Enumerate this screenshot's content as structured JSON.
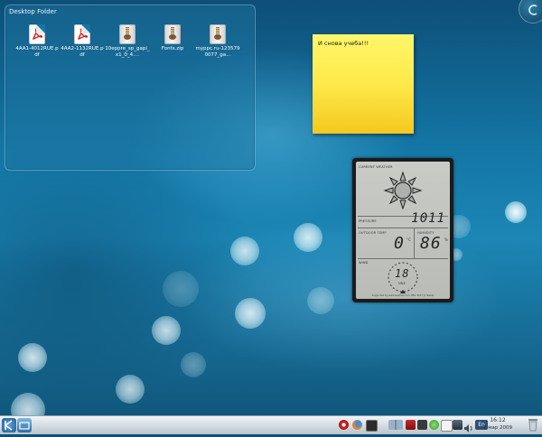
{
  "desktop": {
    "folder_view": {
      "title": "Desktop Folder",
      "files": [
        {
          "name": "4AA1-4012RUE.pdf",
          "type": "pdf"
        },
        {
          "name": "4AA2-1132RUE.pdf",
          "type": "pdf"
        },
        {
          "name": "10eppre_sp_gapi_x1_0_4....",
          "type": "zip"
        },
        {
          "name": "Fonts.zip",
          "type": "zip"
        },
        {
          "name": "myppc.ru-1235790077_ga...",
          "type": "zip"
        }
      ]
    },
    "sticky_note": {
      "text": "И снова учеба!!!",
      "color": "#ffe94a"
    },
    "weather_widget": {
      "heading": "CURRENT WEATHER",
      "condition_icon": "sun-icon",
      "pressure_label": "PRESSURE",
      "pressure_value": "1011",
      "outdoor_label": "OUTDOOR TEMP",
      "outdoor_value": "0",
      "outdoor_unit": "°C",
      "humidity_label": "HUMIDITY",
      "humidity_value": "86",
      "humidity_unit": "%",
      "wind_label": "WIND",
      "wind_value": "18",
      "wind_direction": "NNE",
      "footer": "Supported by www.weather.com. BBC 2007 Jo Nisbet"
    },
    "corner_toolbox_icon": "cashew-icon"
  },
  "taskbar": {
    "left_icons": [
      "kde-menu-icon",
      "show-desktop-icon"
    ],
    "tray_icons": [
      "opera-icon",
      "firefox-icon",
      "terminal-icon",
      "pager-icon",
      "audio-mixer-icon",
      "network-icon",
      "update-icon",
      "klipper-icon",
      "display-icon",
      "volume-icon",
      "keyboard-layout-icon"
    ],
    "keyboard_layout": "En",
    "clock": {
      "time": "16:12",
      "date": "2 мар 2009"
    },
    "trash_icon": "trash-icon"
  }
}
